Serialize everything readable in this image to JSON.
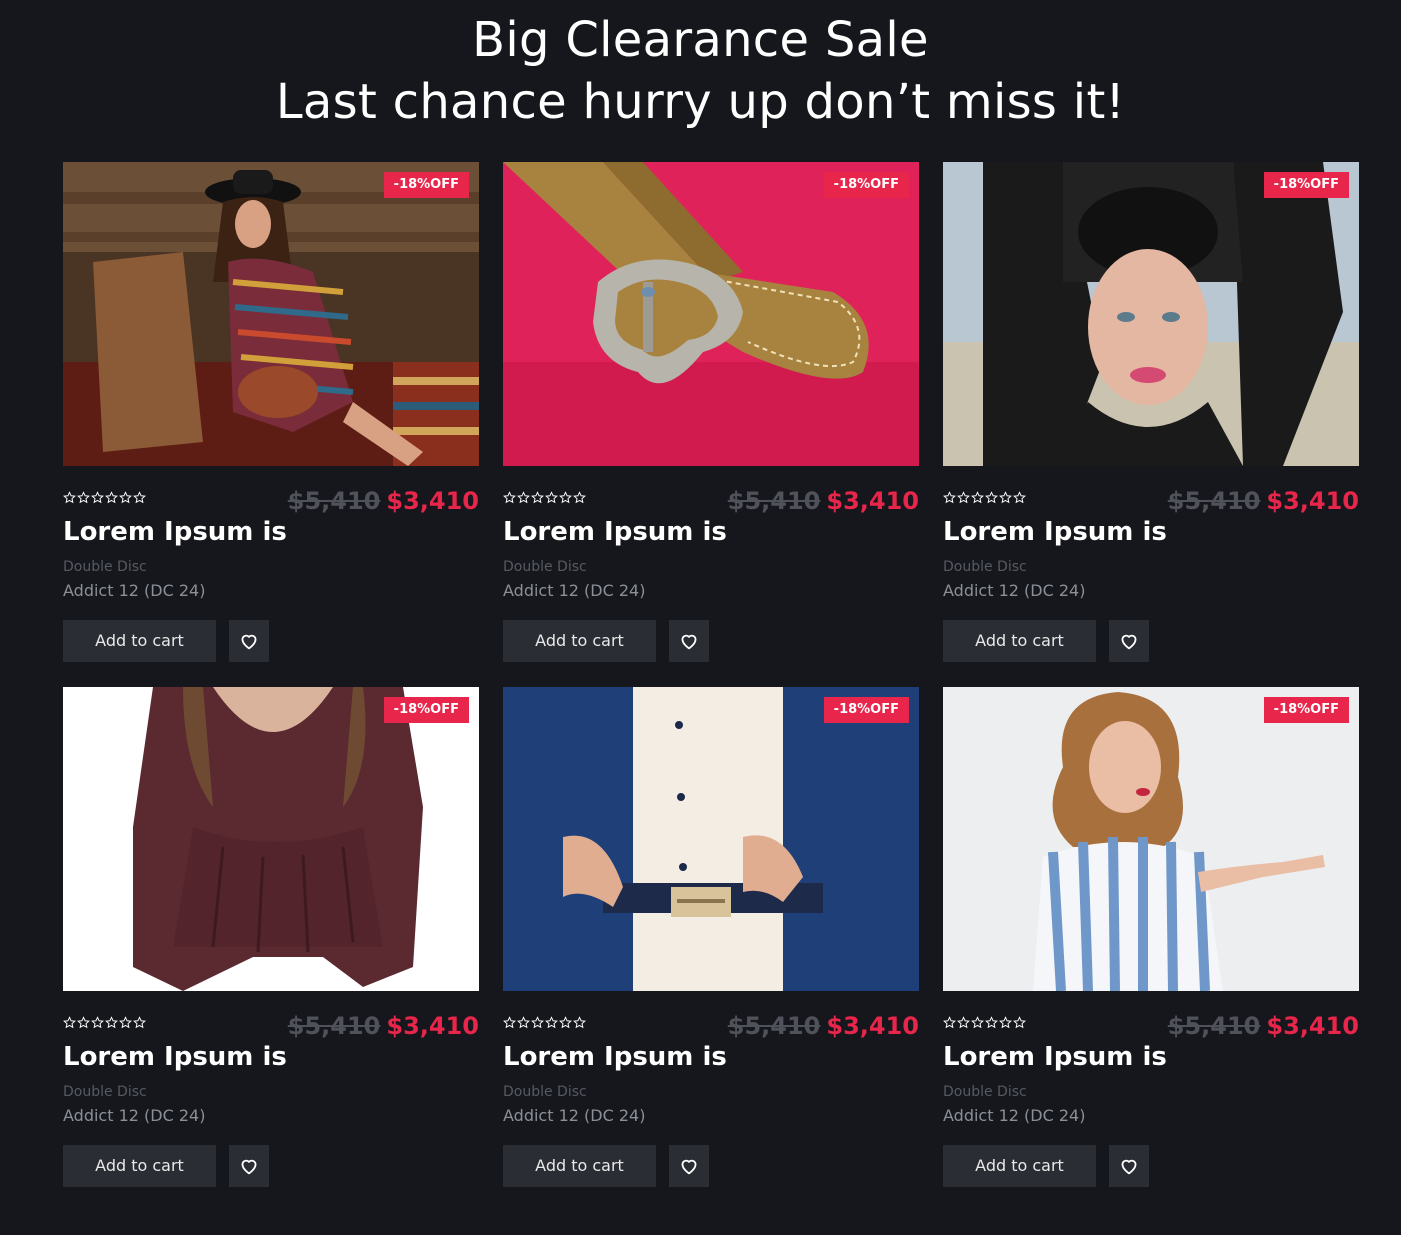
{
  "heading": {
    "line1": "Big Clearance Sale",
    "line2": "Last chance hurry up don’t miss it!"
  },
  "colors": {
    "background": "#15171c",
    "accent": "#e8264b",
    "button": "#2a2d33",
    "old_price": "#4f525a"
  },
  "products": [
    {
      "badge": "-18%OFF",
      "old_price": "$5,410",
      "new_price": "$3,410",
      "title": "Lorem Ipsum is",
      "subtitle": "Double Disc",
      "detail": "Addict 12 (DC 24)",
      "cart_label": "Add to cart",
      "rating": 0,
      "rating_max": 6,
      "image": "woman-striped-dress-photo"
    },
    {
      "badge": "-18%OFF",
      "old_price": "$5,410",
      "new_price": "$3,410",
      "title": "Lorem Ipsum is",
      "subtitle": "Double Disc",
      "detail": "Addict 12 (DC 24)",
      "cart_label": "Add to cart",
      "rating": 0,
      "rating_max": 6,
      "image": "suede-buckle-photo"
    },
    {
      "badge": "-18%OFF",
      "old_price": "$5,410",
      "new_price": "$3,410",
      "title": "Lorem Ipsum is",
      "subtitle": "Double Disc",
      "detail": "Addict 12 (DC 24)",
      "cart_label": "Add to cart",
      "rating": 0,
      "rating_max": 6,
      "image": "woman-black-lace-photo"
    },
    {
      "badge": "-18%OFF",
      "old_price": "$5,410",
      "new_price": "$3,410",
      "title": "Lorem Ipsum is",
      "subtitle": "Double Disc",
      "detail": "Addict 12 (DC 24)",
      "cart_label": "Add to cart",
      "rating": 0,
      "rating_max": 6,
      "image": "burgundy-blouse-photo"
    },
    {
      "badge": "-18%OFF",
      "old_price": "$5,410",
      "new_price": "$3,410",
      "title": "Lorem Ipsum is",
      "subtitle": "Double Disc",
      "detail": "Addict 12 (DC 24)",
      "cart_label": "Add to cart",
      "rating": 0,
      "rating_max": 6,
      "image": "man-suit-belt-photo"
    },
    {
      "badge": "-18%OFF",
      "old_price": "$5,410",
      "new_price": "$3,410",
      "title": "Lorem Ipsum is",
      "subtitle": "Double Disc",
      "detail": "Addict 12 (DC 24)",
      "cart_label": "Add to cart",
      "rating": 0,
      "rating_max": 6,
      "image": "woman-striped-shirt-photo"
    }
  ]
}
